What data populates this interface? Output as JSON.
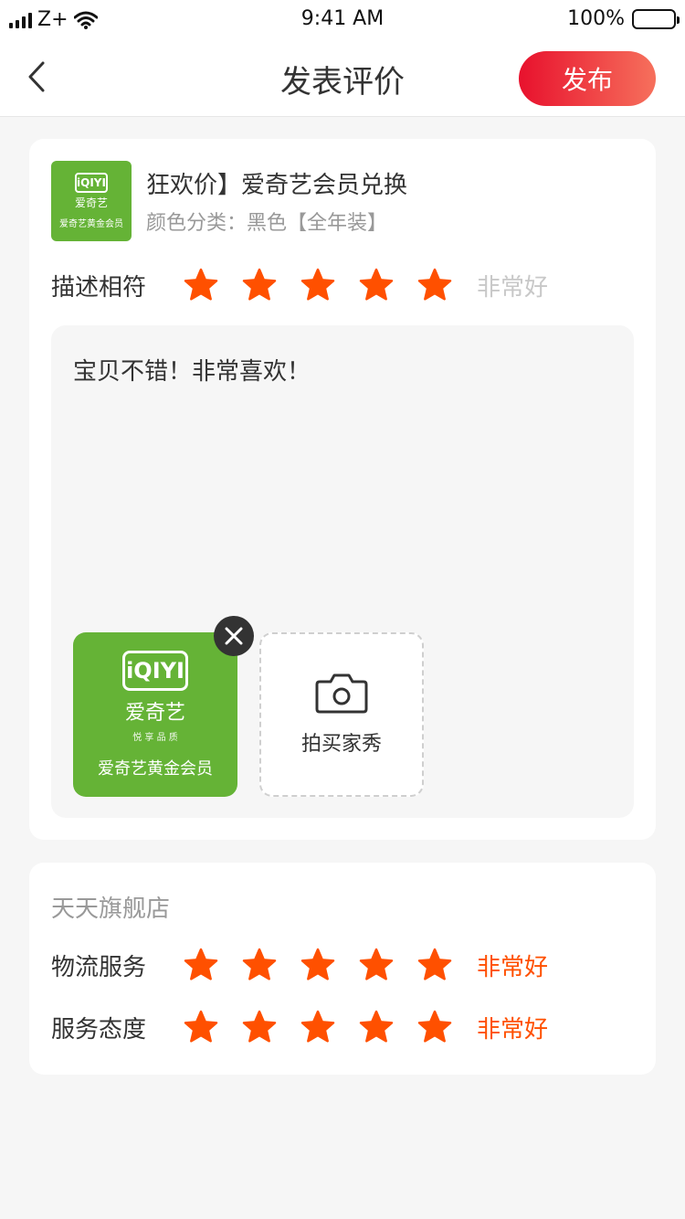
{
  "status_bar": {
    "carrier": "Z+",
    "time": "9:41 AM",
    "battery": "100%"
  },
  "nav": {
    "title": "发表评价",
    "publish_label": "发布"
  },
  "product": {
    "thumb_logo": "iQIYI",
    "thumb_brand": "爱奇艺",
    "thumb_sub": "爱奇艺黄金会员",
    "name": "狂欢价】爱奇艺会员兑换",
    "spec": "颜色分类：黑色【全年装】"
  },
  "description_rating": {
    "label": "描述相符",
    "stars": 5,
    "max": 5,
    "text": "非常好"
  },
  "comment": {
    "text": "宝贝不错！非常喜欢！"
  },
  "photo": {
    "logo": "iQIYI",
    "brand": "爱奇艺",
    "tagline": "悦 享 品 质",
    "sub": "爱奇艺黄金会员"
  },
  "upload": {
    "label": "拍买家秀"
  },
  "shop": {
    "name": "天天旗舰店",
    "ratings": [
      {
        "label": "物流服务",
        "stars": 5,
        "max": 5,
        "text": "非常好"
      },
      {
        "label": "服务态度",
        "stars": 5,
        "max": 5,
        "text": "非常好"
      }
    ]
  },
  "colors": {
    "star": "#ff5000",
    "accent_start": "#e8112d",
    "accent_end": "#f6705c",
    "brand_green": "#65b336"
  }
}
